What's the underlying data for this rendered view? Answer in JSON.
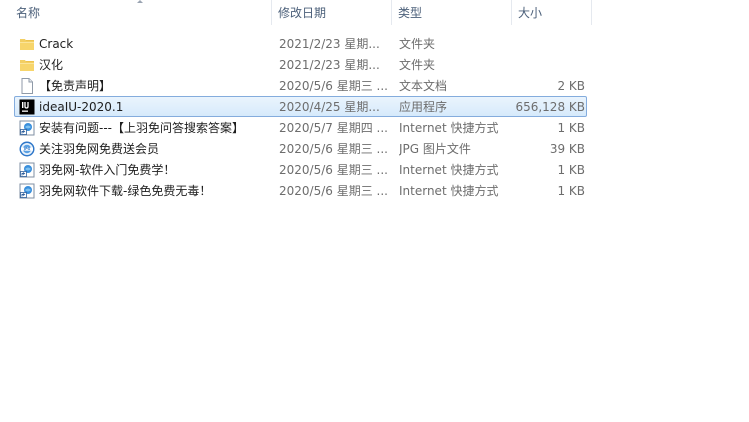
{
  "columns": {
    "name": "名称",
    "date": "修改日期",
    "type": "类型",
    "size": "大小"
  },
  "files": [
    {
      "icon": "folder-icon",
      "name": "Crack",
      "date": "2021/2/23 星期...",
      "type": "文件夹",
      "size": ""
    },
    {
      "icon": "folder-icon",
      "name": "汉化",
      "date": "2021/2/23 星期...",
      "type": "文件夹",
      "size": ""
    },
    {
      "icon": "text-document-icon",
      "name": "【免责声明】",
      "date": "2020/5/6 星期三 ...",
      "type": "文本文档",
      "size": "2 KB"
    },
    {
      "icon": "intellij-idea-icon",
      "name": "ideaIU-2020.1",
      "date": "2020/4/25 星期...",
      "type": "应用程序",
      "size": "656,128 KB"
    },
    {
      "icon": "internet-shortcut-icon",
      "name": "安装有问题---【上羽免问答搜索答案】",
      "date": "2020/5/7 星期四 ...",
      "type": "Internet 快捷方式",
      "size": "1 KB"
    },
    {
      "icon": "jpg-image-icon",
      "name": "关注羽免网免费送会员",
      "date": "2020/5/6 星期三 ...",
      "type": "JPG 图片文件",
      "size": "39 KB"
    },
    {
      "icon": "internet-shortcut-icon",
      "name": "羽免网-软件入门免费学！",
      "date": "2020/5/6 星期三 ...",
      "type": "Internet 快捷方式",
      "size": "1 KB"
    },
    {
      "icon": "internet-shortcut-icon",
      "name": "羽免网软件下载-绿色免费无毒！",
      "date": "2020/5/6 星期三 ...",
      "type": "Internet 快捷方式",
      "size": "1 KB"
    }
  ],
  "selected_file": "ideaIU-2020.1"
}
